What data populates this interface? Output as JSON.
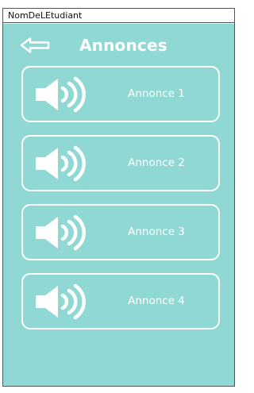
{
  "window": {
    "title": "NomDeLEtudiant"
  },
  "header": {
    "title": "Annonces",
    "back_icon": "arrow-left-icon"
  },
  "announcements": [
    {
      "label": "Annonce 1",
      "icon": "speaker-icon"
    },
    {
      "label": "Annonce 2",
      "icon": "speaker-icon"
    },
    {
      "label": "Annonce 3",
      "icon": "speaker-icon"
    },
    {
      "label": "Annonce 4",
      "icon": "speaker-icon"
    }
  ],
  "colors": {
    "background": "#8fd8d3",
    "foreground": "#ffffff"
  }
}
